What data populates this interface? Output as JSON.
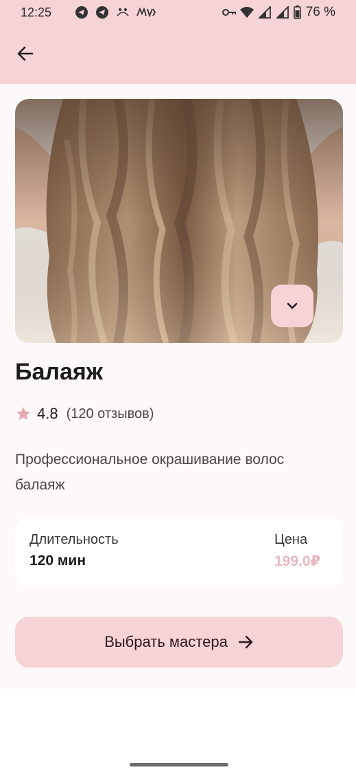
{
  "status_bar": {
    "time": "12:25",
    "battery": "76 %",
    "icons_left": [
      "telegram-icon",
      "telegram-icon",
      "wellness-icon",
      "mvideo-icon"
    ],
    "icons_right": [
      "key-icon",
      "wifi-icon",
      "signal-icon",
      "signal-icon",
      "battery-icon"
    ]
  },
  "app_bar": {
    "back_icon": "arrow-left-icon",
    "background": "#f5d3d7"
  },
  "service": {
    "title": "Балаяж",
    "rating": "4.8",
    "reviews": "(120 отзывов)",
    "description": "Профессиональное окрашивание волос балаяж"
  },
  "info": {
    "duration_label": "Длительность",
    "duration_value": "120 мин",
    "price_label": "Цена",
    "price_value": "199.0₽"
  },
  "cta": {
    "label": "Выбрать мастера",
    "icon": "arrow-right-icon"
  },
  "colors": {
    "accent": "#f5d3d7",
    "price": "#e7b7bd",
    "star": "#e7a9b1",
    "background": "#fdf8f9"
  }
}
